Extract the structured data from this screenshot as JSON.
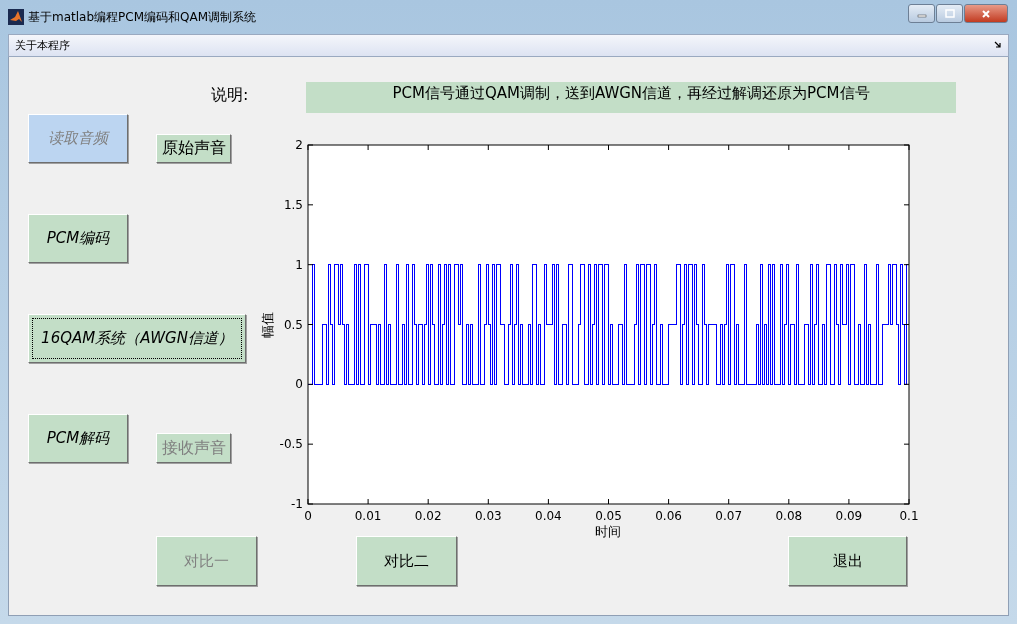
{
  "window": {
    "title": "基于matlab编程PCM编码和QAM调制系统"
  },
  "menu": [
    {
      "label": "关于本程序"
    }
  ],
  "description": {
    "label": "说明:",
    "text": "PCM信号通过QAM调制，送到AWGN信道，再经过解调还原为PCM信号"
  },
  "buttons": [
    {
      "label": "读取音频",
      "kind": "large",
      "disabled": true,
      "hovered": true,
      "focused": false
    },
    {
      "label": "原始声音",
      "kind": "small",
      "disabled": false,
      "hovered": false,
      "focused": false
    },
    {
      "label": "PCM编码",
      "kind": "large",
      "disabled": false,
      "hovered": false,
      "focused": false
    },
    {
      "label": "16QAM系统（AWGN信道）",
      "kind": "large",
      "disabled": false,
      "hovered": false,
      "focused": true
    },
    {
      "label": "PCM解码",
      "kind": "large",
      "disabled": false,
      "hovered": false,
      "focused": false
    },
    {
      "label": "接收声音",
      "kind": "small",
      "disabled": true,
      "hovered": false,
      "focused": false
    },
    {
      "label": "对比一",
      "kind": "plain",
      "disabled": true,
      "hovered": false,
      "focused": false
    },
    {
      "label": "对比二",
      "kind": "plain",
      "disabled": false,
      "hovered": false,
      "focused": false
    },
    {
      "label": "退出",
      "kind": "plain",
      "disabled": false,
      "hovered": false,
      "focused": false
    }
  ],
  "plot": {
    "xlabel": "时间",
    "ylabel": "幅值",
    "xticks": [
      "0",
      "0.01",
      "0.02",
      "0.03",
      "0.04",
      "0.05",
      "0.06",
      "0.07",
      "0.08",
      "0.09",
      "0.1"
    ],
    "yticks": [
      "2",
      "1.5",
      "1",
      "0.5",
      "0",
      "-0.5",
      "-1"
    ]
  }
}
